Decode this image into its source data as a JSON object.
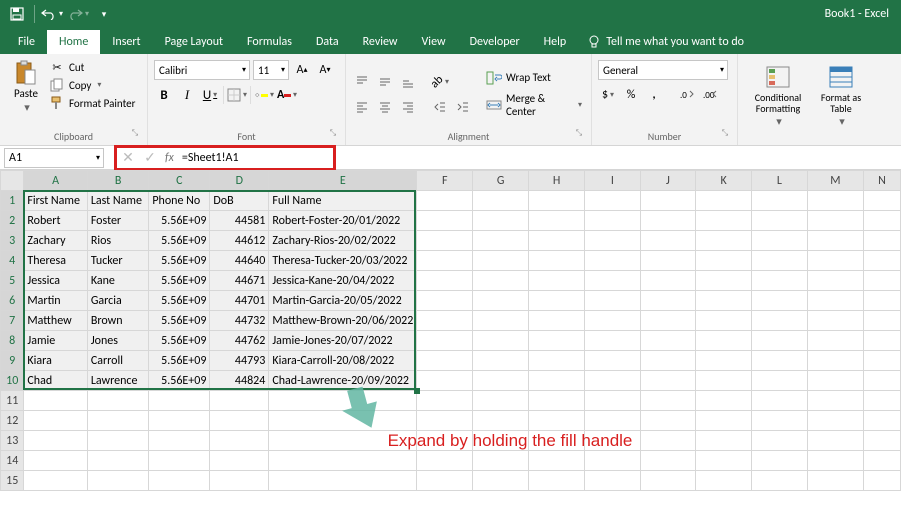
{
  "title": "Book1 - Excel",
  "tabs": [
    "File",
    "Home",
    "Insert",
    "Page Layout",
    "Formulas",
    "Data",
    "Review",
    "View",
    "Developer",
    "Help"
  ],
  "active_tab": "Home",
  "tellme": "Tell me what you want to do",
  "ribbon": {
    "clipboard": {
      "paste": "Paste",
      "cut": "Cut",
      "copy": "Copy",
      "painter": "Format Painter",
      "label": "Clipboard"
    },
    "font": {
      "name": "Calibri",
      "size": "11",
      "label": "Font"
    },
    "alignment": {
      "wrap": "Wrap Text",
      "merge": "Merge & Center",
      "label": "Alignment"
    },
    "number": {
      "format": "General",
      "label": "Number"
    },
    "styles": {
      "cond": "Conditional Formatting",
      "table": "Format as Table"
    }
  },
  "namebox": "A1",
  "formula": "=Sheet1!A1",
  "columns": [
    "A",
    "B",
    "C",
    "D",
    "E",
    "F",
    "G",
    "H",
    "I",
    "J",
    "K",
    "L",
    "M",
    "N"
  ],
  "headers": [
    "First Name",
    "Last Name",
    "Phone No",
    "DoB",
    "Full Name"
  ],
  "rows": [
    {
      "fn": "Robert",
      "ln": "Foster",
      "ph": "5.56E+09",
      "dob": "44581",
      "full": "Robert-Foster-20/01/2022"
    },
    {
      "fn": "Zachary",
      "ln": "Rios",
      "ph": "5.56E+09",
      "dob": "44612",
      "full": "Zachary-Rios-20/02/2022"
    },
    {
      "fn": "Theresa",
      "ln": "Tucker",
      "ph": "5.56E+09",
      "dob": "44640",
      "full": "Theresa-Tucker-20/03/2022"
    },
    {
      "fn": "Jessica",
      "ln": "Kane",
      "ph": "5.56E+09",
      "dob": "44671",
      "full": "Jessica-Kane-20/04/2022"
    },
    {
      "fn": "Martin",
      "ln": "Garcia",
      "ph": "5.56E+09",
      "dob": "44701",
      "full": "Martin-Garcia-20/05/2022"
    },
    {
      "fn": "Matthew",
      "ln": "Brown",
      "ph": "5.56E+09",
      "dob": "44732",
      "full": "Matthew-Brown-20/06/2022"
    },
    {
      "fn": "Jamie",
      "ln": "Jones",
      "ph": "5.56E+09",
      "dob": "44762",
      "full": "Jamie-Jones-20/07/2022"
    },
    {
      "fn": "Kiara",
      "ln": "Carroll",
      "ph": "5.56E+09",
      "dob": "44793",
      "full": "Kiara-Carroll-20/08/2022"
    },
    {
      "fn": "Chad",
      "ln": "Lawrence",
      "ph": "5.56E+09",
      "dob": "44824",
      "full": "Chad-Lawrence-20/09/2022"
    }
  ],
  "annotation": "Expand by holding the fill\nhandle"
}
